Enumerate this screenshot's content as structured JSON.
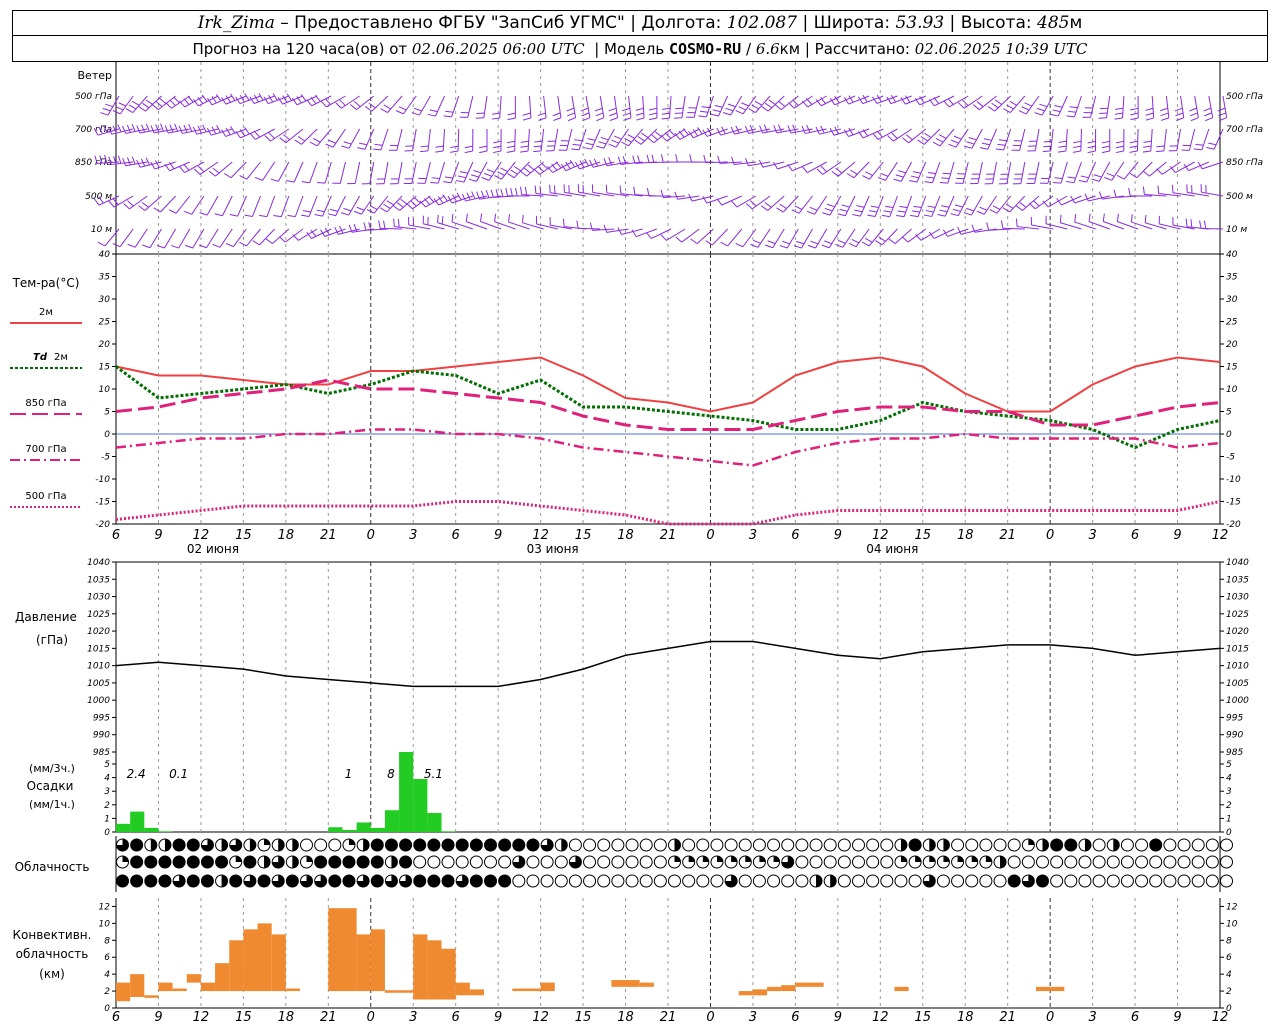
{
  "header": {
    "station": "Irk_Zima",
    "sep1": "–",
    "provided_by": "Предоставлено ФГБУ \"ЗапСиб УГМС\"",
    "lon_label": "Долгота:",
    "lon_value": "102.087",
    "lat_label": "Широта:",
    "lat_value": "53.93",
    "alt_label": "Высота:",
    "alt_value": "485",
    "alt_unit": "м",
    "forecast_prefix": "Прогноз на 120 часа(ов) от",
    "forecast_start": "02.06.2025 06:00 UTC",
    "model_label": "Модель",
    "model_name": "COSMO-RU",
    "model_res": "6.6",
    "model_res_unit": "км",
    "calc_label": "Рассчитано:",
    "calc_time": "02.06.2025 10:39 UTC"
  },
  "colors": {
    "wind": "#8a2be2",
    "t2m": "#f04040",
    "td2m": "#007000",
    "t850": "#e0207a",
    "t700": "#e0207a",
    "t500": "#e0207a",
    "precip": "#22cc22",
    "conv": "#f08a30",
    "zero_line": "#4a6fd8"
  },
  "chart_data": [
    {
      "type": "wind_barbs",
      "label": "Ветер",
      "levels": [
        "500 гПа",
        "700 гПа",
        "850 гПа",
        "500 м",
        "10 м"
      ],
      "x_hours_step": 1,
      "x_range": [
        0,
        78
      ],
      "note_speed": [
        10,
        10,
        8,
        8,
        4
      ]
    },
    {
      "type": "line",
      "title": "Тем-ра(°С)",
      "ylim": [
        -20,
        40
      ],
      "yticks": [
        -20,
        -15,
        -10,
        -5,
        0,
        5,
        10,
        15,
        20,
        25,
        30,
        35,
        40
      ],
      "xtick_labels": [
        "6",
        "9",
        "12",
        "15",
        "18",
        "21",
        "0",
        "3",
        "6",
        "9",
        "12",
        "15",
        "18",
        "21",
        "0",
        "3",
        "6",
        "9",
        "12",
        "15",
        "18",
        "21",
        "0",
        "3",
        "6",
        "9",
        "12"
      ],
      "day_labels": [
        "02 июня",
        "03 июня",
        "04 июня"
      ],
      "legend": [
        {
          "key": "t2m",
          "label": "2м"
        },
        {
          "key": "td2m",
          "label_prefix": "Td",
          "label": "2м"
        },
        {
          "key": "t850",
          "label": "850 гПа"
        },
        {
          "key": "t700",
          "label": "700 гПа"
        },
        {
          "key": "t500",
          "label": "500 гПа"
        }
      ],
      "x_hours": [
        0,
        3,
        6,
        9,
        12,
        15,
        18,
        21,
        24,
        27,
        30,
        33,
        36,
        39,
        42,
        45,
        48,
        51,
        54,
        57,
        60,
        63,
        66,
        69,
        72,
        75,
        78
      ],
      "series": [
        {
          "key": "t2m",
          "values": [
            15,
            13,
            13,
            12,
            11,
            11,
            14,
            14,
            15,
            16,
            17,
            13,
            8,
            7,
            5,
            7,
            13,
            16,
            17,
            15,
            9,
            5,
            5,
            11,
            15,
            17,
            16
          ]
        },
        {
          "key": "td2m",
          "values": [
            15,
            8,
            9,
            10,
            11,
            9,
            11,
            14,
            13,
            9,
            12,
            6,
            6,
            5,
            4,
            3,
            1,
            1,
            3,
            7,
            5,
            4,
            3,
            1,
            -3,
            1,
            3
          ]
        },
        {
          "key": "t850",
          "values": [
            5,
            6,
            8,
            9,
            10,
            12,
            10,
            10,
            9,
            8,
            7,
            4,
            2,
            1,
            1,
            1,
            3,
            5,
            6,
            6,
            5,
            5,
            2,
            2,
            4,
            6,
            7
          ]
        },
        {
          "key": "t700",
          "values": [
            -3,
            -2,
            -1,
            -1,
            0,
            0,
            1,
            1,
            0,
            0,
            -1,
            -3,
            -4,
            -5,
            -6,
            -7,
            -4,
            -2,
            -1,
            -1,
            0,
            -1,
            -1,
            -1,
            -1,
            -3,
            -2
          ]
        },
        {
          "key": "t500",
          "values": [
            -19,
            -18,
            -17,
            -16,
            -16,
            -16,
            -16,
            -16,
            -15,
            -15,
            -16,
            -17,
            -18,
            -20,
            -21,
            -20,
            -18,
            -17,
            -17,
            -17,
            -17,
            -17,
            -17,
            -17,
            -17,
            -17,
            -15
          ]
        }
      ]
    },
    {
      "type": "line",
      "title": "Давление",
      "unit": "(гПа)",
      "ylim": [
        985,
        1040
      ],
      "yticks": [
        985,
        990,
        995,
        1000,
        1005,
        1010,
        1015,
        1020,
        1025,
        1030,
        1035,
        1040
      ],
      "x_hours": [
        0,
        3,
        6,
        9,
        12,
        15,
        18,
        21,
        24,
        27,
        30,
        33,
        36,
        39,
        42,
        45,
        48,
        51,
        54,
        57,
        60,
        63,
        66,
        69,
        72,
        75,
        78
      ],
      "series": [
        {
          "key": "pressure",
          "values": [
            1010,
            1011,
            1010,
            1009,
            1007,
            1006,
            1005,
            1004,
            1004,
            1004,
            1006,
            1009,
            1013,
            1015,
            1017,
            1017,
            1015,
            1013,
            1012,
            1014,
            1015,
            1016,
            1016,
            1015,
            1013,
            1014,
            1015
          ]
        }
      ]
    },
    {
      "type": "bar",
      "title": "Осадки",
      "unit_3h": "(мм/3ч.)",
      "unit_1h": "(мм/1ч.)",
      "ylim": [
        0,
        5
      ],
      "yticks": [
        0,
        1,
        2,
        3,
        4,
        5
      ],
      "hours": [
        0,
        1,
        2,
        3,
        15,
        16,
        17,
        18,
        19,
        20,
        21,
        22,
        23
      ],
      "values": [
        0.6,
        1.5,
        0.3,
        0.05,
        0.35,
        0.15,
        0.7,
        0.3,
        1.6,
        6.0,
        3.9,
        1.4,
        0.05
      ],
      "labels": [
        {
          "h": 1,
          "text": "2.4"
        },
        {
          "h": 4,
          "text": "0.1"
        },
        {
          "h": 16,
          "text": "1"
        },
        {
          "h": 19,
          "text": "8"
        },
        {
          "h": 22,
          "text": "5.1"
        }
      ]
    },
    {
      "type": "table",
      "title": "Облачность",
      "rows": [
        "3422443232122000124444444444443200000002000000000000000242200000124420200400000",
        "1444444414232144444240000000300030000001111111130000000111111120000000000000000",
        "4444344243434334434334443444000000000000000300000220000003000004340000000000000"
      ]
    },
    {
      "type": "bar",
      "title": "Конвективн. облачность",
      "unit": "(км)",
      "ylim": [
        0,
        13
      ],
      "yticks": [
        0,
        2,
        4,
        6,
        8,
        10,
        12
      ],
      "bars": [
        {
          "h": 0,
          "base": 0.8,
          "top": 3
        },
        {
          "h": 1,
          "base": 1.3,
          "top": 4
        },
        {
          "h": 2,
          "base": 1.2,
          "top": 1.5
        },
        {
          "h": 3,
          "base": 2,
          "top": 3
        },
        {
          "h": 4,
          "base": 2,
          "top": 2.3
        },
        {
          "h": 5,
          "base": 3,
          "top": 4
        },
        {
          "h": 6,
          "base": 2,
          "top": 3
        },
        {
          "h": 7,
          "base": 2,
          "top": 5.3
        },
        {
          "h": 8,
          "base": 2,
          "top": 8
        },
        {
          "h": 9,
          "base": 2,
          "top": 9.3
        },
        {
          "h": 10,
          "base": 2,
          "top": 10
        },
        {
          "h": 11,
          "base": 2,
          "top": 8.7
        },
        {
          "h": 12,
          "base": 2,
          "top": 2.3
        },
        {
          "h": 15,
          "base": 2,
          "top": 11.8
        },
        {
          "h": 16,
          "base": 2,
          "top": 11.8
        },
        {
          "h": 17,
          "base": 2,
          "top": 8.7
        },
        {
          "h": 18,
          "base": 2,
          "top": 9.3
        },
        {
          "h": 19,
          "base": 1.8,
          "top": 2.1
        },
        {
          "h": 20,
          "base": 1.8,
          "top": 2.1
        },
        {
          "h": 21,
          "base": 1,
          "top": 8.7
        },
        {
          "h": 22,
          "base": 1,
          "top": 8
        },
        {
          "h": 23,
          "base": 1,
          "top": 7
        },
        {
          "h": 24,
          "base": 1.5,
          "top": 3
        },
        {
          "h": 25,
          "base": 1.5,
          "top": 2.2
        },
        {
          "h": 28,
          "base": 2,
          "top": 2.3
        },
        {
          "h": 29,
          "base": 2,
          "top": 2.3
        },
        {
          "h": 30,
          "base": 2,
          "top": 3
        },
        {
          "h": 35,
          "base": 2.5,
          "top": 3.3
        },
        {
          "h": 36,
          "base": 2.5,
          "top": 3.3
        },
        {
          "h": 37,
          "base": 2.5,
          "top": 3
        },
        {
          "h": 44,
          "base": 1.5,
          "top": 2
        },
        {
          "h": 45,
          "base": 1.5,
          "top": 2.2
        },
        {
          "h": 46,
          "base": 2,
          "top": 2.5
        },
        {
          "h": 47,
          "base": 2,
          "top": 2.7
        },
        {
          "h": 48,
          "base": 2.5,
          "top": 3
        },
        {
          "h": 49,
          "base": 2.5,
          "top": 3
        },
        {
          "h": 55,
          "base": 2,
          "top": 2.5
        },
        {
          "h": 65,
          "base": 2,
          "top": 2.5
        },
        {
          "h": 66,
          "base": 2,
          "top": 2.5
        }
      ]
    }
  ]
}
